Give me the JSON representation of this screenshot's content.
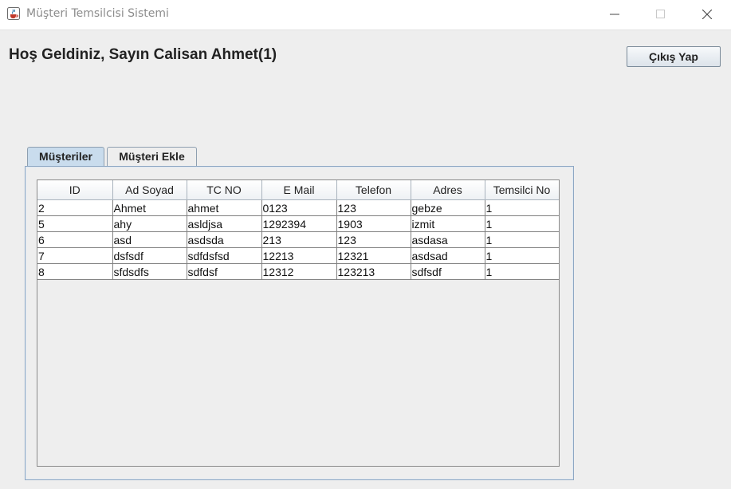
{
  "window": {
    "title": "Müşteri Temsilcisi Sistemi",
    "icons": {
      "app": "java-cup-icon",
      "minimize": "minimize-icon",
      "maximize": "maximize-icon",
      "close": "close-icon"
    }
  },
  "header": {
    "welcome": "Hoş Geldiniz, Sayın Calisan Ahmet(1)",
    "logout_label": "Çıkış Yap"
  },
  "tabs": [
    {
      "label": "Müşteriler",
      "selected": true
    },
    {
      "label": "Müşteri Ekle",
      "selected": false
    }
  ],
  "table": {
    "columns": [
      "ID",
      "Ad Soyad",
      "TC NO",
      "E Mail",
      "Telefon",
      "Adres",
      "Temsilci No"
    ],
    "rows": [
      [
        "2",
        "Ahmet",
        "ahmet",
        "0123",
        "123",
        "gebze",
        "1"
      ],
      [
        "5",
        "ahy",
        "asldjsa",
        "1292394",
        "1903",
        "izmit",
        "1"
      ],
      [
        "6",
        "asd",
        "asdsda",
        "213",
        "123",
        "asdasa",
        "1"
      ],
      [
        "7",
        "dsfsdf",
        "sdfdsfsd",
        "12213",
        "12321",
        "asdsad",
        "1"
      ],
      [
        "8",
        "sfdsdfs",
        "sdfdsf",
        "12312",
        "123213",
        "sdfsdf",
        "1"
      ]
    ]
  },
  "colors": {
    "tab_selected": "#c9dced",
    "panel_border": "#8ea7c3",
    "background": "#eeeeee"
  }
}
